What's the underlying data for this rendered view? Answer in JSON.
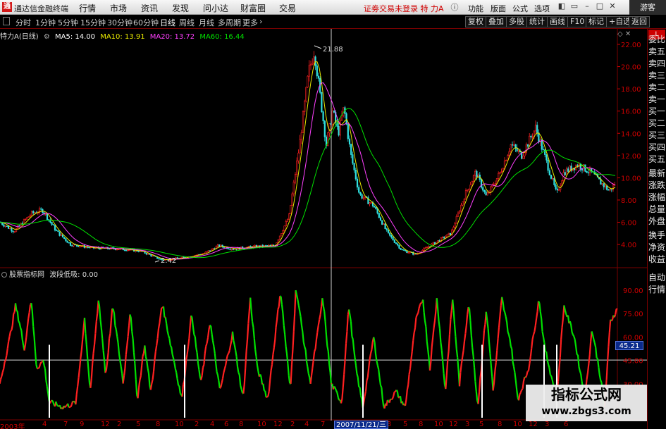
{
  "app": {
    "logo": "通",
    "title": "通达信金融终端"
  },
  "menu": {
    "items": [
      "行情",
      "市场",
      "资讯",
      "发现",
      "问小达",
      "财富圈",
      "交易"
    ],
    "warning": "证劵交易未登录  特 力A",
    "right_items": [
      "功能",
      "版面",
      "公式",
      "选项"
    ],
    "guest": "游客"
  },
  "toolbar": {
    "periods": [
      "分时",
      "1分钟",
      "5分钟",
      "15分钟",
      "30分钟",
      "60分钟",
      "日线",
      "周线",
      "月线",
      "多周期",
      "更多"
    ],
    "active_period": "日线",
    "right_buttons": [
      "复权",
      "叠加",
      "多股",
      "统计",
      "画线",
      "F10",
      "标记",
      "+自选",
      "返回"
    ]
  },
  "legend": {
    "stock": "特力A(日线)",
    "ma5": "MA5: 14.00",
    "ma10": "MA10: 13.91",
    "ma20": "MA20: 13.72",
    "ma60": "MA60: 16.44",
    "colors": {
      "ma5": "#ffffff",
      "ma10": "#e8e800",
      "ma20": "#ff40ff",
      "ma60": "#00e000"
    }
  },
  "price_axis": [
    "22.00",
    "20.00",
    "18.00",
    "16.00",
    "14.00",
    "12.00",
    "10.00",
    "8.00",
    "6.00",
    "4.00"
  ],
  "price_annotations": {
    "high": "21.88",
    "low": "2.42"
  },
  "indicator": {
    "name": "股票指标网",
    "label": "波段低吸: 0.00",
    "axis": [
      "90.00",
      "75.00",
      "60.00",
      "45.00",
      "30.00"
    ],
    "current_value": "45.21"
  },
  "right_panel": {
    "corner": "L",
    "items": [
      "委比",
      "卖五",
      "卖四",
      "卖三",
      "卖二",
      "卖一",
      "买一",
      "买二",
      "买三",
      "买四",
      "买五",
      "最新",
      "涨跌",
      "涨幅",
      "总量",
      "外盘",
      "换手",
      "净资",
      "收益"
    ],
    "bottom_items": [
      "自动",
      "行情"
    ]
  },
  "date_axis": {
    "labels": [
      "2003年",
      "4",
      "7",
      "9",
      "12",
      "2",
      "5",
      "8",
      "10",
      "2",
      "4",
      "6",
      "8",
      "10",
      "12",
      "2",
      "4",
      "7",
      "9",
      "11",
      "3",
      "5",
      "8",
      "10",
      "12",
      "3",
      "5",
      "8",
      "10",
      "12",
      "3",
      "6"
    ],
    "cursor_date": "2007/11/21/三"
  },
  "watermark": {
    "title": "指标公式网",
    "url": "www.zbgs3.com"
  },
  "colors": {
    "up": "#ff2020",
    "down": "#00e000",
    "axis": "#d00000",
    "grid": "#7a0000"
  }
}
